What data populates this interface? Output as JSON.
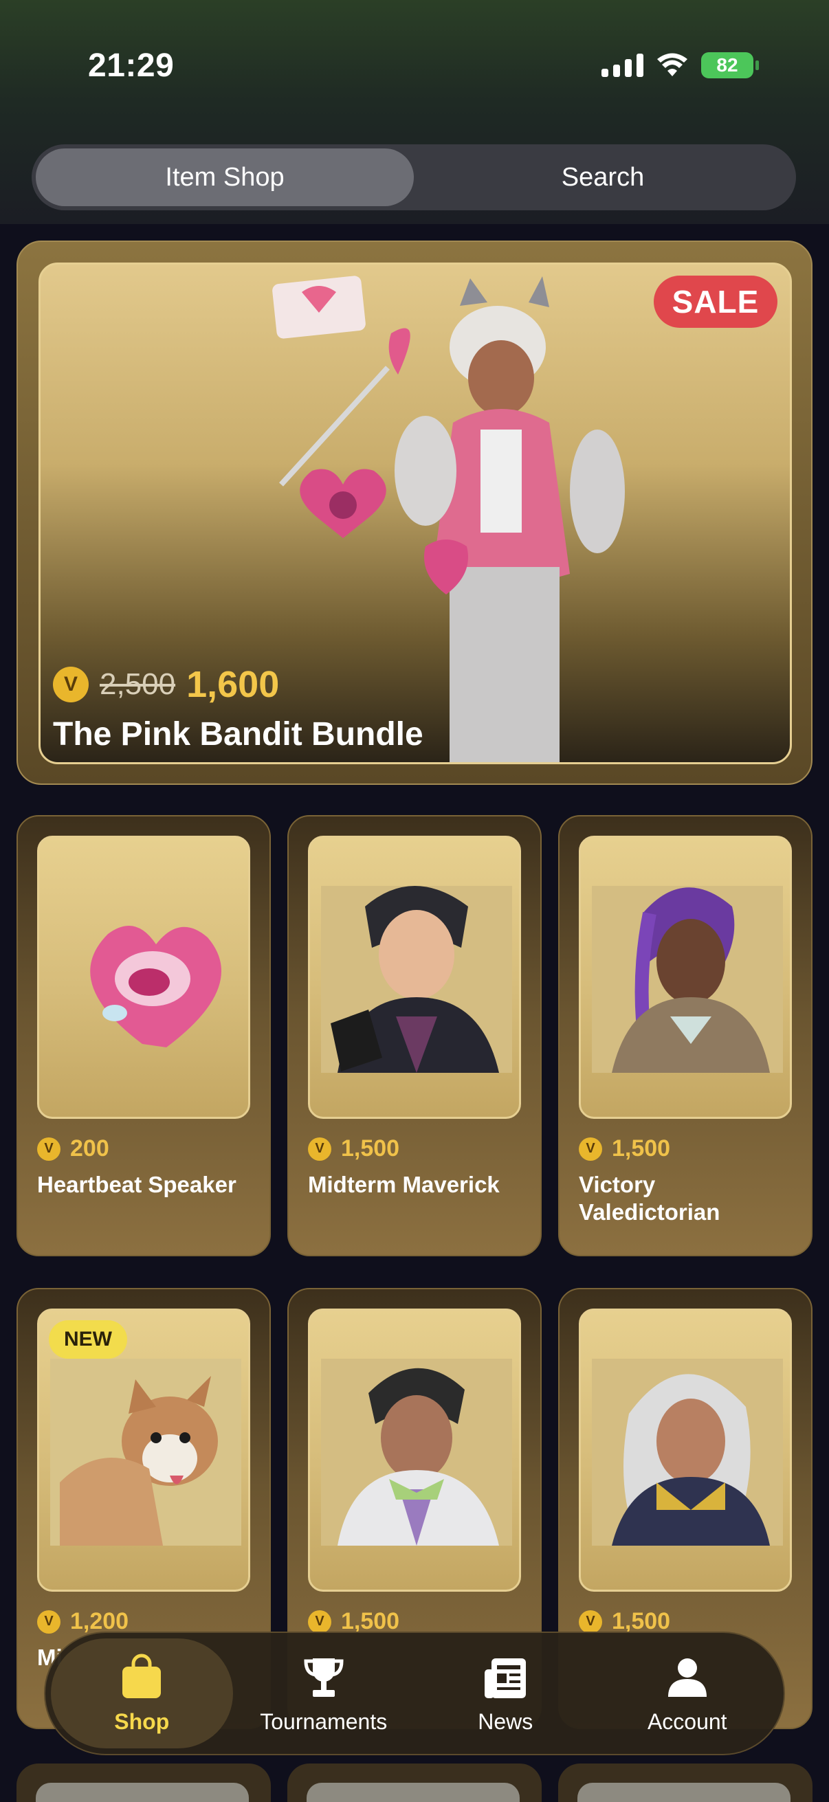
{
  "status": {
    "time": "21:29",
    "battery": "82"
  },
  "tabs_top": [
    {
      "label": "Item Shop",
      "active": true
    },
    {
      "label": "Search",
      "active": false
    }
  ],
  "featured": {
    "badge": "SALE",
    "currency_symbol": "V",
    "old_price": "2,500",
    "price": "1,600",
    "name": "The Pink Bandit Bundle"
  },
  "items": [
    {
      "price": "200",
      "name": "Heartbeat Speaker",
      "image": "heart-speaker-icon"
    },
    {
      "price": "1,500",
      "name": "Midterm Maverick",
      "image": "character-portrait"
    },
    {
      "price": "1,500",
      "name": "Victory Valedictorian",
      "image": "character-portrait"
    },
    {
      "price": "1,200",
      "name": "Mi",
      "badge": "NEW",
      "image": "shiba-dog-icon"
    },
    {
      "price": "1,500",
      "name": "",
      "image": "character-portrait"
    },
    {
      "price": "1,500",
      "name": "",
      "image": "character-portrait"
    }
  ],
  "tabbar": [
    {
      "label": "Shop",
      "icon": "shopping-bag-icon",
      "active": true
    },
    {
      "label": "Tournaments",
      "icon": "trophy-icon",
      "active": false
    },
    {
      "label": "News",
      "icon": "newspaper-icon",
      "active": false
    },
    {
      "label": "Account",
      "icon": "person-icon",
      "active": false
    }
  ],
  "colors": {
    "accent": "#f6d84c",
    "sale": "#e0474c",
    "vbuck": "#e9b62c",
    "gold": "#e2c98c"
  }
}
